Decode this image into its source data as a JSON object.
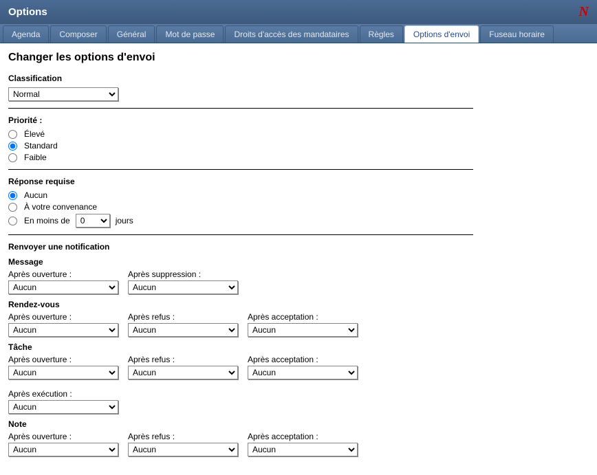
{
  "title": "Options",
  "tabs": [
    {
      "label": "Agenda"
    },
    {
      "label": "Composer"
    },
    {
      "label": "Général"
    },
    {
      "label": "Mot de passe"
    },
    {
      "label": "Droits d'accès des mandataires"
    },
    {
      "label": "Règles"
    },
    {
      "label": "Options d'envoi",
      "active": true
    },
    {
      "label": "Fuseau horaire"
    }
  ],
  "heading": "Changer les options d'envoi",
  "classification": {
    "label": "Classification",
    "value": "Normal"
  },
  "priority": {
    "label": "Priorité :",
    "options": {
      "high": "Élevé",
      "standard": "Standard",
      "low": "Faible"
    },
    "selected": "standard"
  },
  "reply": {
    "label": "Réponse requise",
    "options": {
      "none": "Aucun",
      "convenient": "À votre convenance",
      "within": "En moins de"
    },
    "selected": "none",
    "days_value": "0",
    "days_suffix": "jours"
  },
  "notify": {
    "label": "Renvoyer une notification",
    "groups": {
      "message": {
        "label": "Message",
        "cols": [
          {
            "label": "Après ouverture :",
            "value": "Aucun"
          },
          {
            "label": "Après suppression :",
            "value": "Aucun"
          }
        ]
      },
      "appointment": {
        "label": "Rendez-vous",
        "cols": [
          {
            "label": "Après ouverture :",
            "value": "Aucun"
          },
          {
            "label": "Après refus :",
            "value": "Aucun"
          },
          {
            "label": "Après acceptation :",
            "value": "Aucun"
          }
        ]
      },
      "task": {
        "label": "Tâche",
        "cols": [
          {
            "label": "Après ouverture :",
            "value": "Aucun"
          },
          {
            "label": "Après refus :",
            "value": "Aucun"
          },
          {
            "label": "Après acceptation :",
            "value": "Aucun"
          },
          {
            "label": "Après exécution :",
            "value": "Aucun"
          }
        ]
      },
      "note": {
        "label": "Note",
        "cols": [
          {
            "label": "Après ouverture :",
            "value": "Aucun"
          },
          {
            "label": "Après refus :",
            "value": "Aucun"
          },
          {
            "label": "Après acceptation :",
            "value": "Aucun"
          }
        ]
      }
    }
  }
}
